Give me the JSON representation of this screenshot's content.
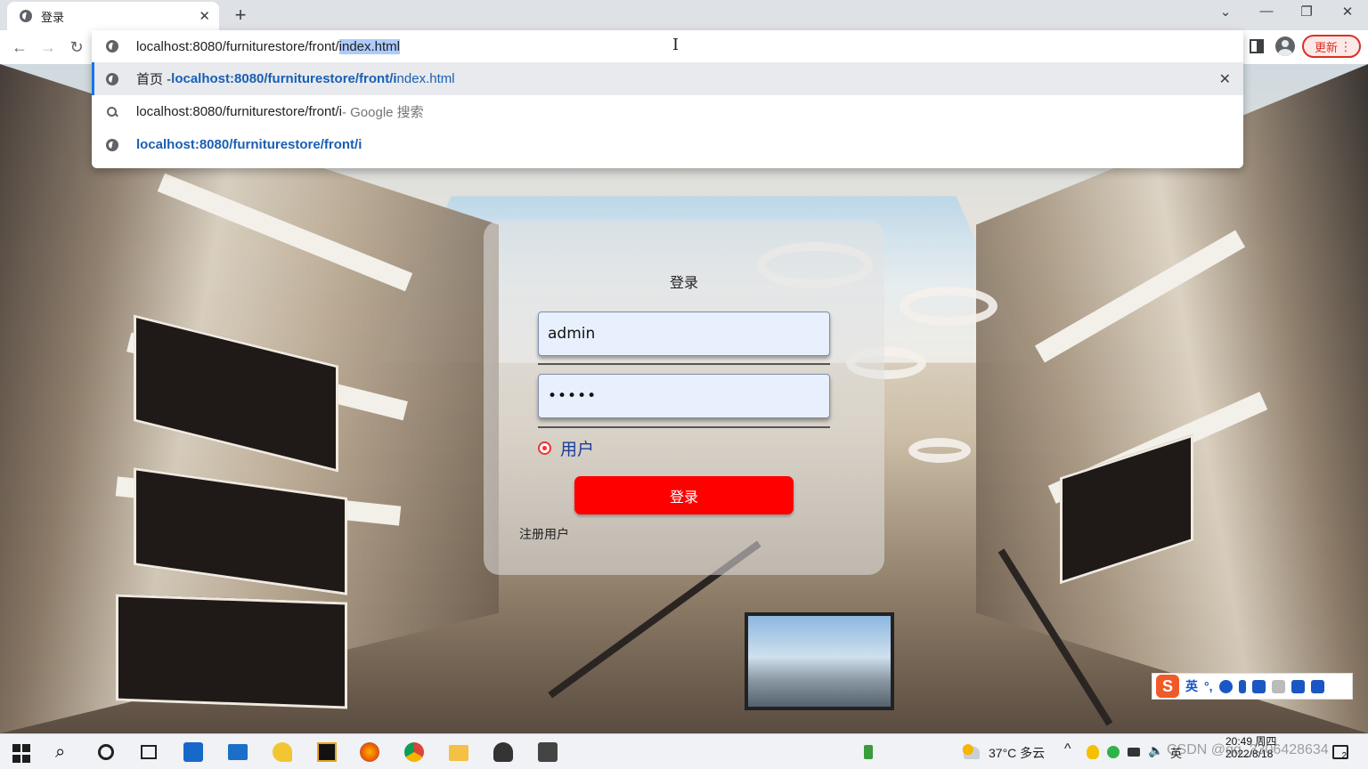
{
  "browser": {
    "tab_title": "登录",
    "tab_close": "✕",
    "new_tab": "+",
    "window_controls": [
      "⌄",
      "—",
      "❐",
      "✕"
    ],
    "address_prefix": "localhost:8080/furniturestore/front/",
    "address_selected": "index.html",
    "update_label": "更新",
    "menu_dots": "⋮",
    "suggestions": [
      {
        "prefix": "首页 - ",
        "bold": "localhost:8080/furniturestore/front/i",
        "rest": "ndex.html",
        "icon": "globe-icon",
        "remove": "✕"
      },
      {
        "text": "localhost:8080/furniturestore/front/i",
        "suffix": " - Google 搜索",
        "icon": "search-icon"
      },
      {
        "bold": "localhost:8080/furniturestore/front/i",
        "icon": "globe-icon"
      }
    ]
  },
  "login": {
    "title": "登录",
    "username_value": "admin",
    "password_value": "•••••",
    "role_label": "用户",
    "submit_label": "登录",
    "register_label": "注册用户"
  },
  "ime": {
    "logo": "S",
    "lang": "英",
    "punct": "°,"
  },
  "taskbar": {
    "weather": "37°C 多云",
    "time": "20:49 周四",
    "date": "2022/8/18",
    "watermark": "CSDN @qq_3306428634",
    "notifications": "2"
  },
  "colors": {
    "accent": "#1a73e8",
    "login_button": "#ff0000",
    "update_red": "#d93025"
  }
}
